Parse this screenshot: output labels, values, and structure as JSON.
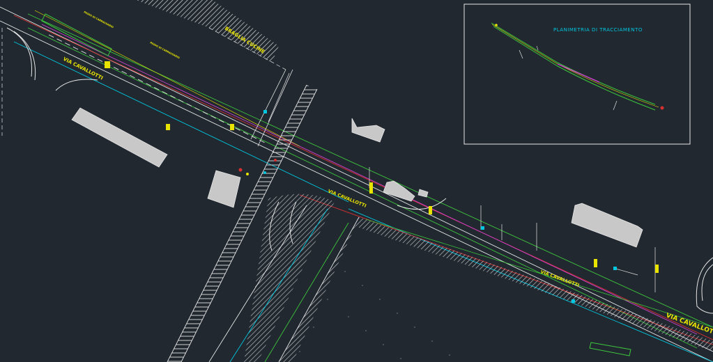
{
  "drawing": {
    "street_labels": {
      "via_cavallotti_1": "VIA CAVALLOTTI",
      "via_cavallotti_2": "VIA CAVALLOTTI",
      "via_cavallotti_3": "VIA CAVALLOTTI",
      "via_cavallotti_4": "VIA CAVALLOTTI"
    },
    "building_label": "BRAGLIA CUCINE",
    "small_labels": {
      "parcel_1": "PASSO DI CARRAI/SARIO",
      "parcel_2": "PASSO DI CARRAI/SARIO"
    }
  },
  "viewport": {
    "title": "PLANIMETRIA DI TRACCIAMENTO"
  },
  "colors": {
    "background": "#212830",
    "yellow": "#e8e400",
    "cyan": "#00c8e0",
    "green": "#3cc83c",
    "red": "#d83030",
    "magenta": "#d040d0",
    "white": "#e6e6e6"
  }
}
